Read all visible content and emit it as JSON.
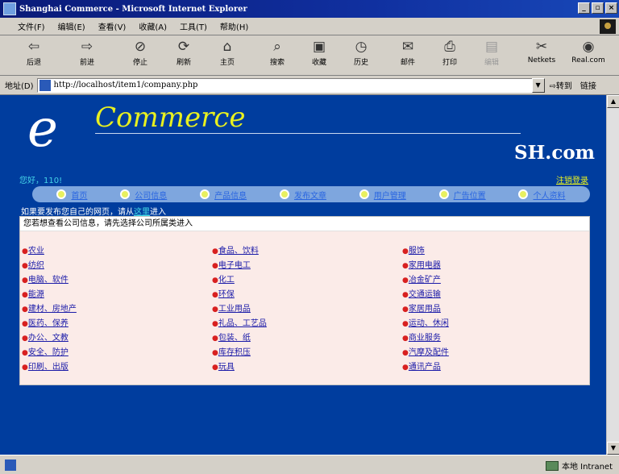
{
  "window": {
    "title": "Shanghai Commerce - Microsoft Internet Explorer",
    "controls": [
      "_",
      "▫",
      "×"
    ]
  },
  "menu": [
    "文件(F)",
    "编辑(E)",
    "查看(V)",
    "收藏(A)",
    "工具(T)",
    "帮助(H)"
  ],
  "toolbar": [
    {
      "label": "后退",
      "icon": "back-arrow-icon",
      "glyph": "⇦"
    },
    {
      "label": "前进",
      "icon": "forward-arrow-icon",
      "glyph": "⇨"
    },
    {
      "label": "停止",
      "icon": "stop-icon",
      "glyph": "⊘"
    },
    {
      "label": "刷新",
      "icon": "refresh-icon",
      "glyph": "⟳"
    },
    {
      "label": "主页",
      "icon": "home-icon",
      "glyph": "⌂"
    },
    {
      "label": "搜索",
      "icon": "search-icon",
      "glyph": "⌕"
    },
    {
      "label": "收藏",
      "icon": "favorites-icon",
      "glyph": "▣"
    },
    {
      "label": "历史",
      "icon": "history-icon",
      "glyph": "◷"
    },
    {
      "label": "邮件",
      "icon": "mail-icon",
      "glyph": "✉"
    },
    {
      "label": "打印",
      "icon": "print-icon",
      "glyph": "⎙"
    },
    {
      "label": "编辑",
      "icon": "edit-icon",
      "glyph": "▤"
    },
    {
      "label": "Netkets",
      "icon": "netkets-icon",
      "glyph": "✂"
    },
    {
      "label": "Real.com",
      "icon": "realcom-icon",
      "glyph": "◉"
    }
  ],
  "address": {
    "label": "地址(D)",
    "url": "http://localhost/item1/company.php",
    "go_label": "⇨转到",
    "links_label": "链接"
  },
  "page": {
    "logo_e": "e",
    "logo_commerce": "Commerce",
    "logo_domain": "SH.com",
    "greeting": "您好，110!",
    "logout": "注销登录",
    "nav": [
      "首页",
      "公司信息",
      "产品信息",
      "发布文章",
      "用户管理",
      "广告位置",
      "个人资料"
    ],
    "publish_prefix": "如果要发布您自己的网页，请从",
    "publish_link": "这里",
    "publish_suffix": "进入",
    "panel_title": "您若想查看公司信息，请先选择公司所属类进入",
    "categories": [
      "农业",
      "食品、饮料",
      "服饰",
      "纺织",
      "电子电工",
      "家用电器",
      "电脑、软件",
      "化工",
      "冶金矿产",
      "能源",
      "环保",
      "交通运输",
      "建材、房地产",
      "工业用品",
      "家居用品",
      "医药、保养",
      "礼品、工艺品",
      "运动、休闲",
      "办公、文教",
      "包装、纸",
      "商业服务",
      "安全、防护",
      "库存积压",
      "汽摩及配件",
      "印刷、出版",
      "玩具",
      "通讯产品"
    ]
  },
  "status": {
    "zone": "本地 Intranet"
  },
  "colors": {
    "page_bg": "#003d9e",
    "panel_bg": "#fbebe8",
    "logo_yellow": "#e8f020",
    "nav_bar": "#7ea6de"
  }
}
